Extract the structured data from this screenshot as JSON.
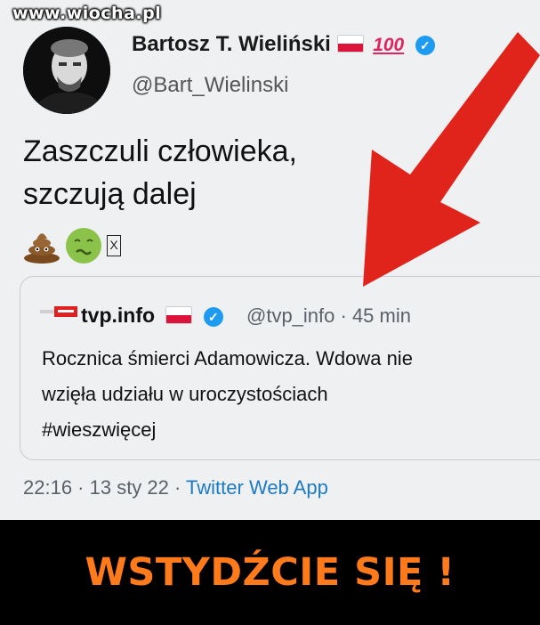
{
  "watermark": "www.wiocha.pl",
  "author": {
    "name": "Bartosz T. Wieliński",
    "hundred": "100",
    "handle": "@Bart_Wielinski"
  },
  "tweet": {
    "line1": "Zaszczuli człowieka,",
    "line2": "szczują dalej",
    "emojis": [
      "pile-of-poo",
      "nauseated-face"
    ],
    "emoji_box": "X"
  },
  "quote": {
    "logo": "TVP INFO",
    "name": "tvp.info",
    "handle_time": "@tvp_info · 45 min",
    "line1": "Rocznica śmierci Adamowicza. Wdowa nie",
    "line2": "wzięła udziału w uroczystościach",
    "line3": "#wieszwięcej"
  },
  "meta": {
    "datetime": "22:16 · 13 sty 22 · ",
    "app": "Twitter Web App"
  },
  "banner": {
    "text": "WSTYDŹCIE SIĘ !"
  },
  "colors": {
    "arrow": "#e0241b",
    "banner_text": "#ff7a1a",
    "verified": "#1d9bf0"
  }
}
